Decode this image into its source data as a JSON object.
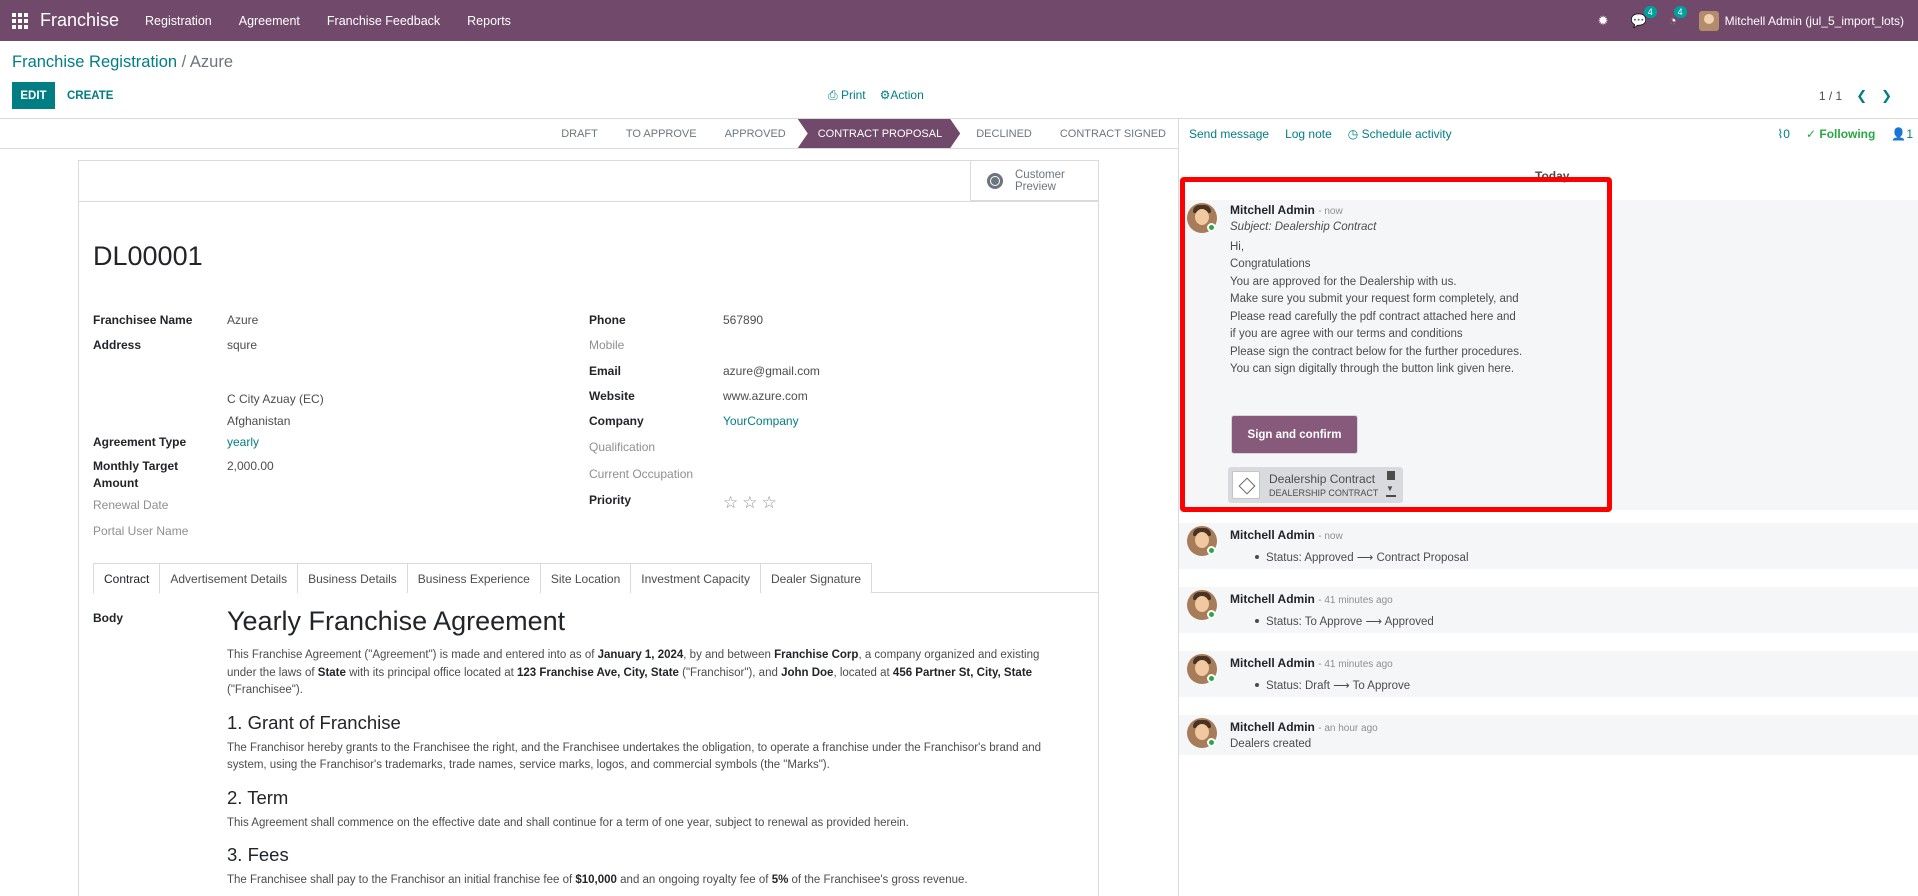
{
  "navbar": {
    "brand": "Franchise",
    "menu": [
      "Registration",
      "Agreement",
      "Franchise Feedback",
      "Reports"
    ],
    "messages_count": "4",
    "activities_count": "4",
    "user": "Mitchell Admin (jul_5_import_lots)"
  },
  "breadcrumb": {
    "parent": "Franchise Registration",
    "separator": " / ",
    "current": "Azure"
  },
  "toolbar": {
    "edit": "EDIT",
    "create": "CREATE",
    "print": "Print",
    "action": "Action",
    "pager": "1 / 1"
  },
  "statusbar": {
    "stages": [
      "DRAFT",
      "TO APPROVE",
      "APPROVED",
      "CONTRACT PROPOSAL",
      "DECLINED",
      "CONTRACT SIGNED"
    ],
    "active": "CONTRACT PROPOSAL"
  },
  "form": {
    "customer_preview": [
      "Customer",
      "Preview"
    ],
    "name": "DL00001",
    "left": {
      "franchisee_name_label": "Franchisee Name",
      "franchisee_name": "Azure",
      "address_label": "Address",
      "street": "squre",
      "city_state": "C City  Azuay (EC)",
      "country": "Afghanistan",
      "agreement_type_label": "Agreement Type",
      "agreement_type": "yearly",
      "monthly_target_label1": "Monthly Target",
      "monthly_target_label2": "Amount",
      "monthly_target": "2,000.00",
      "renewal_date_label": "Renewal Date",
      "portal_user_label": "Portal User Name"
    },
    "right": {
      "phone_label": "Phone",
      "phone": "567890",
      "mobile_label": "Mobile",
      "email_label": "Email",
      "email": "azure@gmail.com",
      "website_label": "Website",
      "website": "www.azure.com",
      "company_label": "Company",
      "company": "YourCompany",
      "qualification_label": "Qualification",
      "occupation_label": "Current Occupation",
      "priority_label": "Priority",
      "priority_stars": 0
    },
    "tabs": [
      "Contract",
      "Advertisement Details",
      "Business Details",
      "Business Experience",
      "Site Location",
      "Investment Capacity",
      "Dealer Signature"
    ],
    "active_tab": "Contract",
    "body_label": "Body"
  },
  "contract": {
    "title": "Yearly Franchise Agreement",
    "intro": {
      "t1": "This Franchise Agreement (\"Agreement\") is made and entered into as of ",
      "date": "January 1, 2024",
      "t2": ", by and between ",
      "franchisor": "Franchise Corp",
      "t3": ", a company organized and existing under the laws of ",
      "state": "State",
      "t4": " with its principal office located at ",
      "franchisor_addr": "123 Franchise Ave, City, State",
      "t5": " (\"Franchisor\"), and ",
      "franchisee": "John Doe",
      "t6": ", located at ",
      "franchisee_addr": "456 Partner St, City, State",
      "t7": " (\"Franchisee\")."
    },
    "s1_title": "1. Grant of Franchise",
    "s1_text": "The Franchisor hereby grants to the Franchisee the right, and the Franchisee undertakes the obligation, to operate a franchise under the Franchisor's brand and system, using the Franchisor's trademarks, trade names, service marks, logos, and commercial symbols (the \"Marks\").",
    "s2_title": "2. Term",
    "s2_text": "This Agreement shall commence on the effective date and shall continue for a term of one year, subject to renewal as provided herein.",
    "s3_title": "3. Fees",
    "s3": {
      "t1": "The Franchisee shall pay to the Franchisor an initial franchise fee of ",
      "fee": "$10,000",
      "t2": " and an ongoing royalty fee of ",
      "royalty": "5%",
      "t3": " of the Franchisee's gross revenue."
    }
  },
  "chatter": {
    "send_message": "Send message",
    "log_note": "Log note",
    "schedule_activity": "Schedule activity",
    "attachments_count": "0",
    "following": "Following",
    "followers_count": "1",
    "today": "Today",
    "messages": [
      {
        "author": "Mitchell Admin",
        "date": "- now",
        "subject": "Subject: Dealership Contract",
        "lines": [
          "Hi,",
          "Congratulations",
          "You are approved for the Dealership with us.",
          "Make sure you submit your request form completely, and",
          "Please read carefully the pdf contract attached here and",
          "if you are agree with our terms and conditions",
          "Please sign the contract below for the further procedures.",
          "You can sign digitally through the button link given here."
        ],
        "button": "Sign and confirm",
        "attachment_name": "Dealership Contract",
        "attachment_sub": "DEALERSHIP CONTRACT"
      },
      {
        "author": "Mitchell Admin",
        "date": "- now",
        "tracking": "Status: Approved ⟶ Contract Proposal"
      },
      {
        "author": "Mitchell Admin",
        "date": "- 41 minutes ago",
        "tracking": "Status: To Approve ⟶ Approved"
      },
      {
        "author": "Mitchell Admin",
        "date": "- 41 minutes ago",
        "tracking": "Status: Draft ⟶ To Approve"
      },
      {
        "author": "Mitchell Admin",
        "date": "- an hour ago",
        "text": "Dealers created"
      }
    ]
  },
  "colors": {
    "brand": "#71496a",
    "accent": "#017e84",
    "highlight": "#ff0000"
  }
}
